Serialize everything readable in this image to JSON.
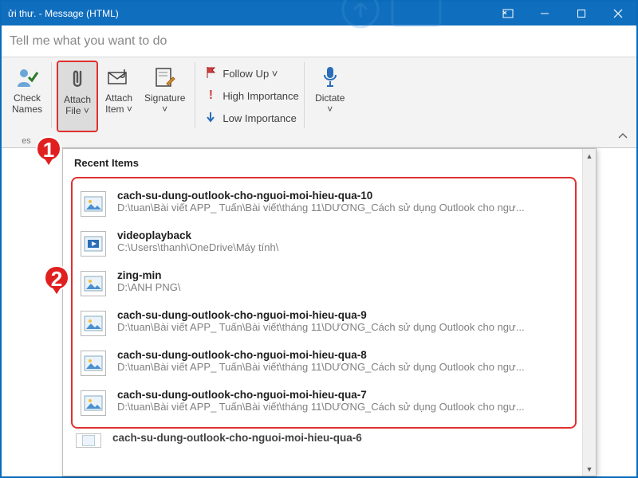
{
  "window": {
    "title": "ửi thư.  -  Message (HTML)"
  },
  "tellme": {
    "placeholder": "Tell me what you want to do"
  },
  "ribbon": {
    "checkNames": "Check\nNames",
    "attachFile": "Attach\nFile ˅",
    "attachItem": "Attach\nItem ˅",
    "signature": "Signature\n˅",
    "followUp": "Follow Up ˅",
    "highImportance": "High Importance",
    "lowImportance": "Low Importance",
    "dictate": "Dictate\n˅",
    "groupLeft": "es"
  },
  "panel": {
    "header": "Recent Items",
    "items": [
      {
        "icon": "image",
        "name": "cach-su-dung-outlook-cho-nguoi-moi-hieu-qua-10",
        "path": "D:\\tuan\\Bài viết APP_ Tuấn\\Bài viết\\tháng 11\\DƯƠNG_Cách sử dụng Outlook cho ngư..."
      },
      {
        "icon": "video",
        "name": "videoplayback",
        "path": "C:\\Users\\thanh\\OneDrive\\Máy tính\\"
      },
      {
        "icon": "image",
        "name": "zing-min",
        "path": "D:\\ANH PNG\\"
      },
      {
        "icon": "image",
        "name": "cach-su-dung-outlook-cho-nguoi-moi-hieu-qua-9",
        "path": "D:\\tuan\\Bài viết APP_ Tuấn\\Bài viết\\tháng 11\\DƯƠNG_Cách sử dụng Outlook cho ngư..."
      },
      {
        "icon": "image",
        "name": "cach-su-dung-outlook-cho-nguoi-moi-hieu-qua-8",
        "path": "D:\\tuan\\Bài viết APP_ Tuấn\\Bài viết\\tháng 11\\DƯƠNG_Cách sử dụng Outlook cho ngư..."
      },
      {
        "icon": "image",
        "name": "cach-su-dung-outlook-cho-nguoi-moi-hieu-qua-7",
        "path": "D:\\tuan\\Bài viết APP_ Tuấn\\Bài viết\\tháng 11\\DƯƠNG_Cách sử dụng Outlook cho ngư..."
      }
    ],
    "overflowItem": {
      "name": "cach-su-dung-outlook-cho-nguoi-moi-hieu-qua-6"
    }
  },
  "callouts": {
    "one": "1",
    "two": "2"
  }
}
